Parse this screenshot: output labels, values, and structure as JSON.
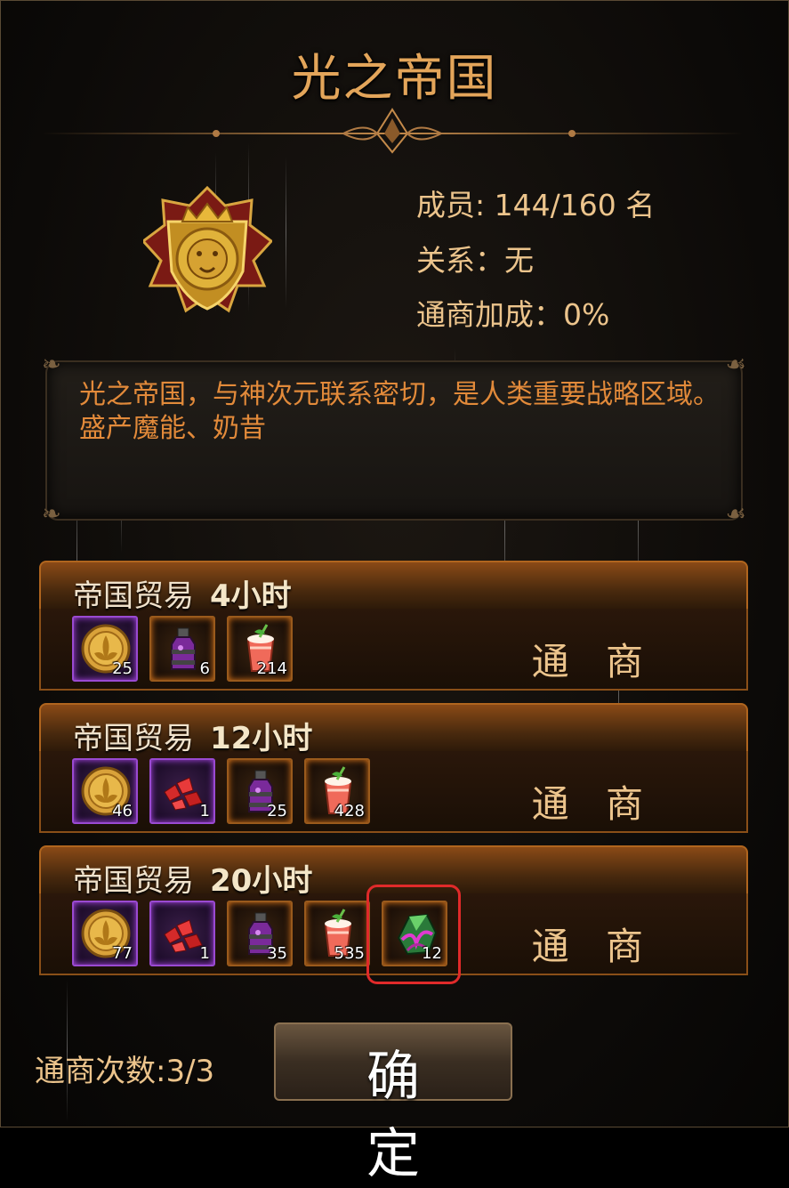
{
  "header": {
    "title": "光之帝国"
  },
  "guild": {
    "members": "成员: 144/160 名",
    "relation": "关系：无",
    "trade_bonus": "通商加成：0%",
    "description": "光之帝国，与神次元联系密切，是人类重要战略区域。盛产魔能、奶昔"
  },
  "trades": [
    {
      "name": "帝国贸易",
      "duration": "4小时",
      "button": "通 商",
      "items": [
        {
          "icon": "gold-coin-icon",
          "quantity": "25",
          "rarity": "purple"
        },
        {
          "icon": "potion-bottle-icon",
          "quantity": "6",
          "rarity": "orange"
        },
        {
          "icon": "milkshake-icon",
          "quantity": "214",
          "rarity": "orange"
        }
      ]
    },
    {
      "name": "帝国贸易",
      "duration": "12小时",
      "button": "通 商",
      "items": [
        {
          "icon": "gold-coin-icon",
          "quantity": "46",
          "rarity": "purple"
        },
        {
          "icon": "red-crystal-icon",
          "quantity": "1",
          "rarity": "purple"
        },
        {
          "icon": "potion-bottle-icon",
          "quantity": "25",
          "rarity": "orange"
        },
        {
          "icon": "milkshake-icon",
          "quantity": "428",
          "rarity": "orange"
        }
      ]
    },
    {
      "name": "帝国贸易",
      "duration": "20小时",
      "button": "通 商",
      "items": [
        {
          "icon": "gold-coin-icon",
          "quantity": "77",
          "rarity": "purple"
        },
        {
          "icon": "red-crystal-icon",
          "quantity": "1",
          "rarity": "purple"
        },
        {
          "icon": "potion-bottle-icon",
          "quantity": "35",
          "rarity": "orange"
        },
        {
          "icon": "milkshake-icon",
          "quantity": "535",
          "rarity": "orange"
        },
        {
          "icon": "green-ore-icon",
          "quantity": "12",
          "rarity": "orange",
          "highlighted": true
        }
      ]
    }
  ],
  "footer": {
    "trade_count": "通商次数:3/3",
    "confirm_label": "确 定"
  },
  "colors": {
    "accent": "#e3a55a",
    "text_gold": "#ecc48c",
    "desc_orange": "#e28a3a",
    "highlight": "#e02a2a"
  }
}
